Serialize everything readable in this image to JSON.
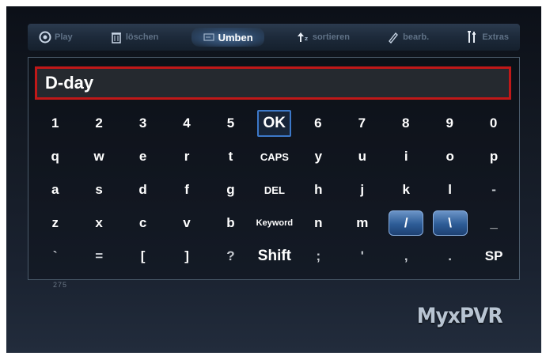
{
  "menu": {
    "items": [
      {
        "label": "Play",
        "icon": "play-circle-icon"
      },
      {
        "label": "löschen",
        "icon": "trash-icon"
      },
      {
        "label": "Umben",
        "icon": "rename-icon",
        "active": true
      },
      {
        "label": "sortieren",
        "icon": "sort-icon"
      },
      {
        "label": "bearb.",
        "icon": "edit-icon"
      },
      {
        "label": "Extras",
        "icon": "tools-icon"
      }
    ]
  },
  "input": {
    "value": "D-day"
  },
  "keyboard": {
    "rows": [
      [
        "1",
        "2",
        "3",
        "4",
        "5",
        "OK",
        "6",
        "7",
        "8",
        "9",
        "0"
      ],
      [
        "q",
        "w",
        "e",
        "r",
        "t",
        "CAPS",
        "y",
        "u",
        "i",
        "o",
        "p"
      ],
      [
        "a",
        "s",
        "d",
        "f",
        "g",
        "DEL",
        "h",
        "j",
        "k",
        "l",
        "-"
      ],
      [
        "z",
        "x",
        "c",
        "v",
        "b",
        "Keyword",
        "n",
        "m",
        "/",
        "\\",
        "_"
      ],
      [
        "`",
        "=",
        "[",
        "]",
        "?",
        "Shift",
        ";",
        "'",
        ",",
        ".",
        "SP"
      ]
    ],
    "selected": "OK"
  },
  "footnote": "275",
  "brand": {
    "logo": "MyxPVR"
  },
  "colors": {
    "highlight": "#c01818",
    "selection": "#3c78c8",
    "accent": "#2d5c96"
  }
}
